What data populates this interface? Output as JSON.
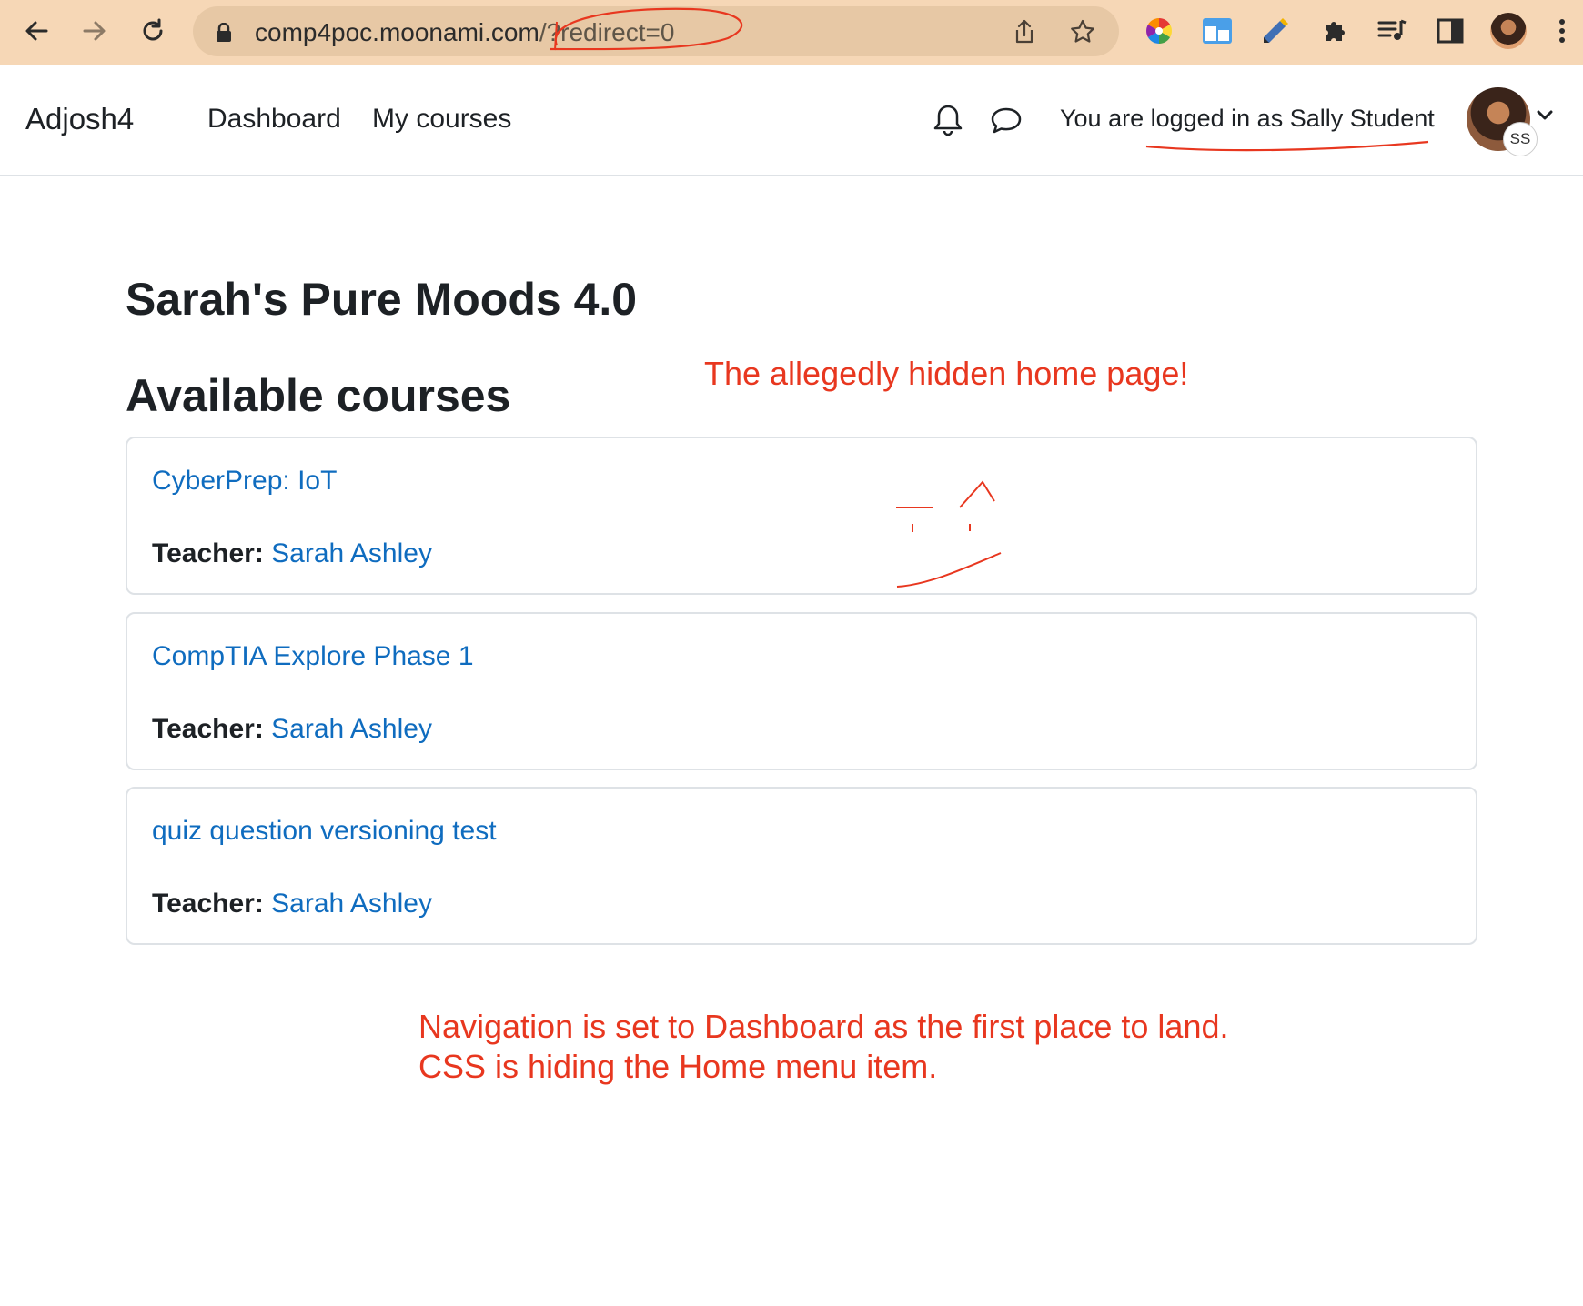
{
  "browser": {
    "url_host": "comp4poc.moonami.com",
    "url_query": "/?redirect=0"
  },
  "navbar": {
    "brand": "Adjosh4",
    "links": [
      {
        "label": "Dashboard"
      },
      {
        "label": "My courses"
      }
    ],
    "logged_in_text": "You are logged in as Sally Student",
    "avatar_initials": "SS"
  },
  "main": {
    "site_title": "Sarah's Pure Moods 4.0",
    "section_title": "Available courses",
    "teacher_label": "Teacher:",
    "courses": [
      {
        "name": "CyberPrep: IoT",
        "teacher": "Sarah Ashley"
      },
      {
        "name": "CompTIA Explore Phase 1",
        "teacher": "Sarah Ashley"
      },
      {
        "name": "quiz question versioning test",
        "teacher": "Sarah Ashley"
      }
    ]
  },
  "annotations": {
    "hidden_home": "The allegedly hidden home page!",
    "note_line1": "Navigation is set to Dashboard as the first place to land.",
    "note_line2": "CSS is hiding the Home menu item."
  },
  "colors": {
    "chrome_bg": "#f6d7b6",
    "link": "#0f6cbf",
    "annotation": "#e8371f"
  }
}
